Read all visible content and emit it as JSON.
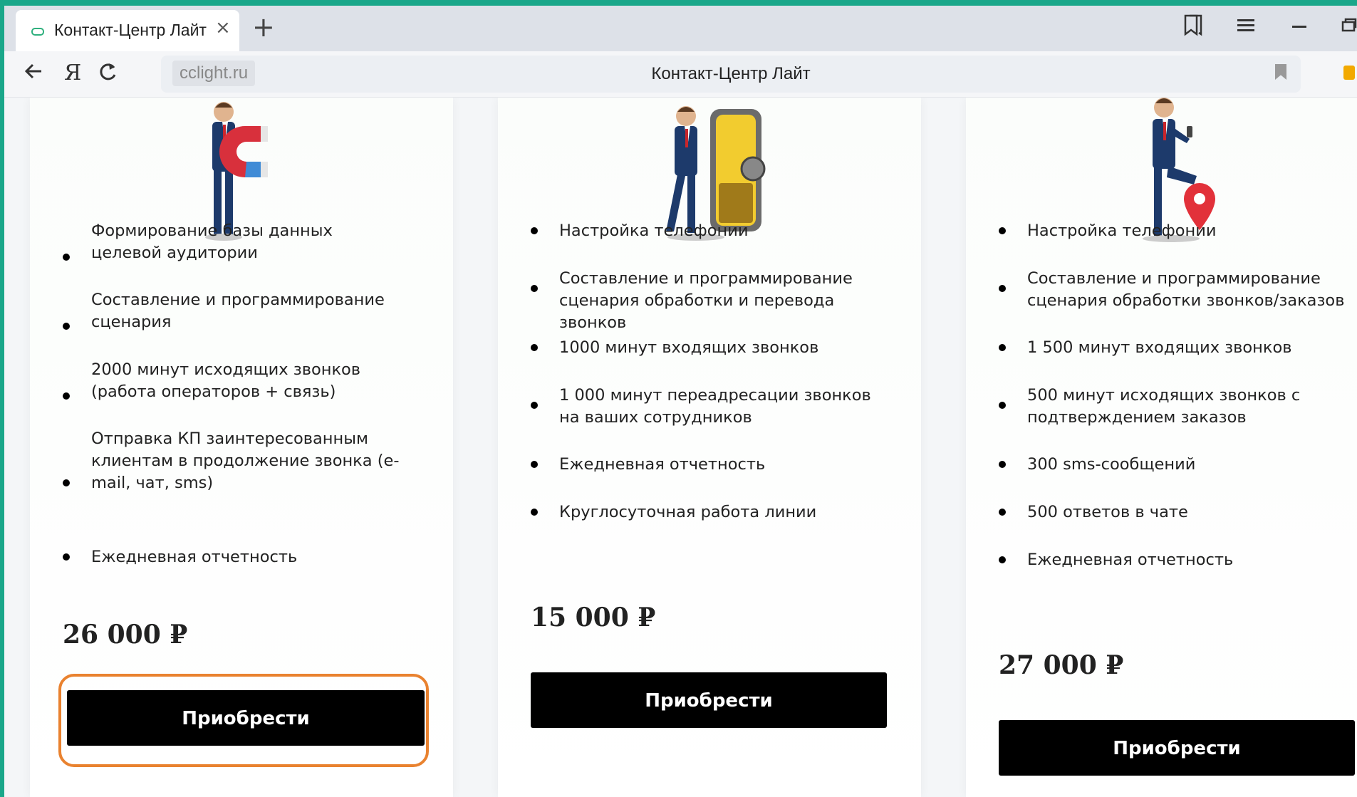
{
  "browser": {
    "tab_title": "Контакт-Центр Лайт",
    "tab_close": "×",
    "new_tab": "+",
    "url_domain": "cclight.ru",
    "page_title": "Контакт-Центр Лайт",
    "icons": [
      "bookmarks-icon",
      "menu-icon",
      "minimize-icon",
      "restore-icon",
      "back-icon",
      "yandex-logo-icon",
      "reload-icon",
      "bookmark-icon"
    ]
  },
  "plans": [
    {
      "image": "businessman-with-magnet",
      "features": [
        "Формирование базы данных целевой аудитории",
        "Составление и программирование сценария",
        "2000 минут исходящих звонков (работа операторов + связь)",
        "Отправка КП заинтересованным клиентам в продолжение звонка (e-mail, чат, sms)",
        "Ежедневная отчетность"
      ],
      "price": "26 000 ₽",
      "button": "Приобрести",
      "highlighted": true
    },
    {
      "image": "businessman-with-safe",
      "features": [
        "Настройка телефонии",
        "Составление и программирование сценария обработки и перевода звонков",
        "1000 минут входящих звонков",
        "1 000 минут переадресации звонков на ваших сотрудников",
        "Ежедневная отчетность",
        "Круглосуточная работа линии"
      ],
      "price": "15 000 ₽",
      "button": "Приобрести",
      "highlighted": false
    },
    {
      "image": "businessman-with-map-pin",
      "features": [
        "Настройка телефонии",
        "Составление и программирование сценария обработки звонков/заказов",
        "1 500 минут входящих звонков",
        "500 минут исходящих звонков с подтверждением заказов",
        "300 sms-сообщений",
        "500 ответов в чате",
        "Ежедневная отчетность"
      ],
      "price": "27 000 ₽",
      "button": "Приобрести",
      "highlighted": false
    }
  ],
  "colors": {
    "frame": "#1aa78a",
    "highlight": "#e9822f",
    "button": "#000000"
  }
}
